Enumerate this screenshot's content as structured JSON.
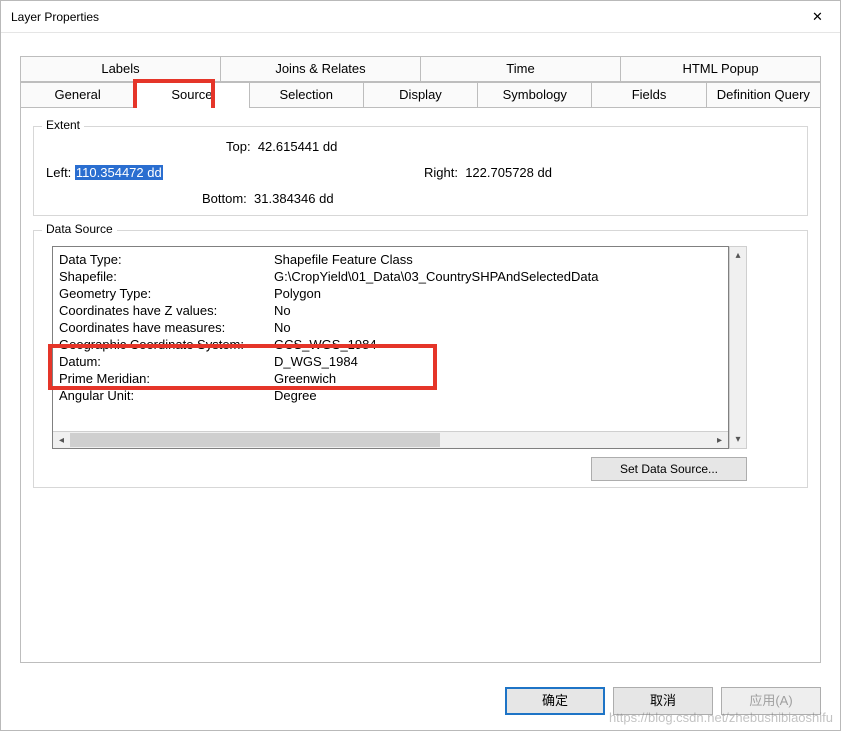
{
  "window": {
    "title": "Layer Properties"
  },
  "tabs_row1": {
    "labels": [
      "Labels",
      "Joins & Relates",
      "Time",
      "HTML Popup"
    ]
  },
  "tabs_row2": {
    "general": "General",
    "source": "Source",
    "selection": "Selection",
    "display": "Display",
    "symbology": "Symbology",
    "fields": "Fields",
    "defquery": "Definition Query"
  },
  "extent": {
    "legend": "Extent",
    "top_lbl": "Top:",
    "top": "42.615441 dd",
    "left_lbl": "Left:",
    "left": "110.354472 dd",
    "right_lbl": "Right:",
    "right": "122.705728 dd",
    "bottom_lbl": "Bottom:",
    "bottom": "31.384346 dd"
  },
  "ds": {
    "legend": "Data Source",
    "rows": [
      {
        "k": "Data Type:",
        "v": "Shapefile Feature Class"
      },
      {
        "k": "Shapefile:",
        "v": "G:\\CropYield\\01_Data\\03_CountrySHPAndSelectedData"
      },
      {
        "k": "Geometry Type:",
        "v": "Polygon"
      },
      {
        "k": "Coordinates have Z values:",
        "v": "No"
      },
      {
        "k": "Coordinates have measures:",
        "v": "No"
      },
      {
        "k": "",
        "v": ""
      },
      {
        "k": "Geographic Coordinate System:",
        "v": "GCS_WGS_1984"
      },
      {
        "k": "Datum:",
        "v": "D_WGS_1984"
      },
      {
        "k": "Prime Meridian:",
        "v": "Greenwich"
      },
      {
        "k": "Angular Unit:",
        "v": "Degree"
      }
    ],
    "setds": "Set Data Source..."
  },
  "buttons": {
    "ok": "确定",
    "cancel": "取消",
    "apply": "应用(A)"
  },
  "watermark": "https://blog.csdn.net/zhebushibiaoshifu"
}
